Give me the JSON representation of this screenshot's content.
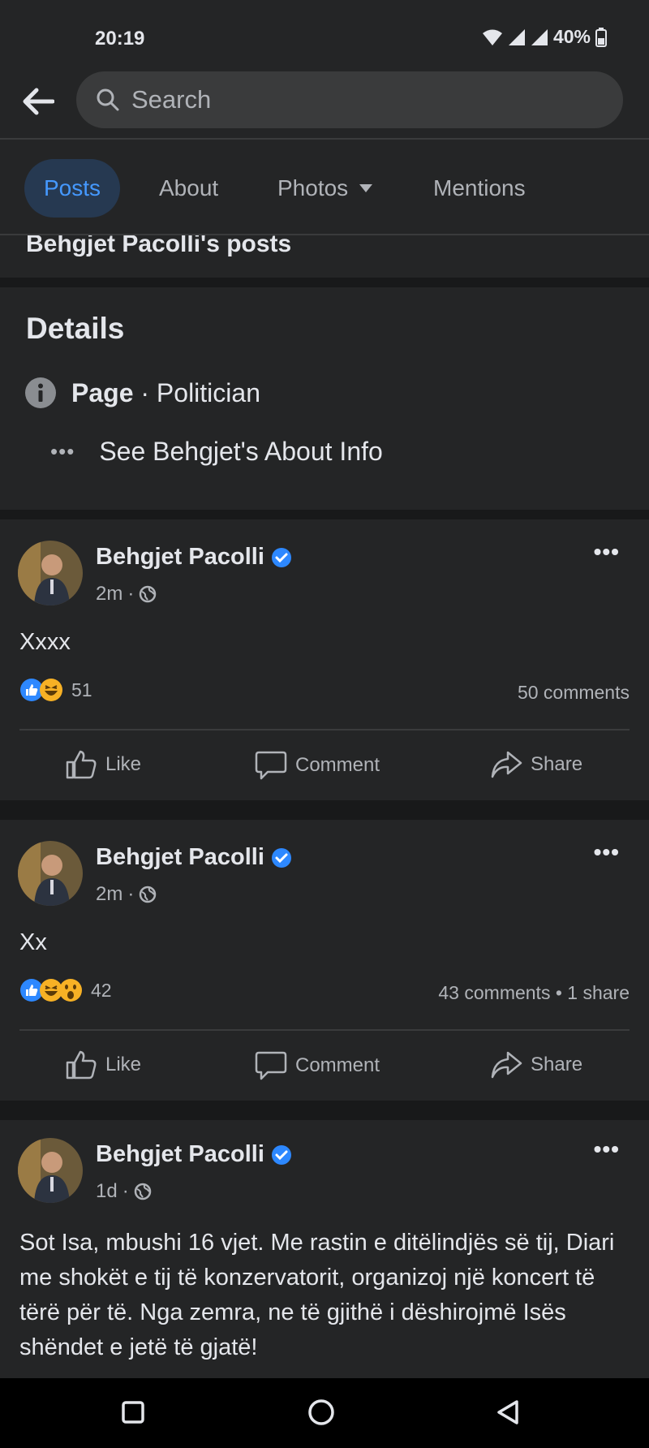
{
  "status": {
    "time": "20:19",
    "battery": "40%"
  },
  "search": {
    "placeholder": "Search"
  },
  "tabs": [
    {
      "label": "Posts"
    },
    {
      "label": "About"
    },
    {
      "label": "Photos"
    },
    {
      "label": "Mentions"
    }
  ],
  "posts_heading": "Behgjet Pacolli's posts",
  "details": {
    "title": "Details",
    "category_strong": "Page",
    "category_sep": " · ",
    "category": "Politician",
    "about_link": "See Behgjet's About Info"
  },
  "posts": [
    {
      "author": "Behgjet Pacolli",
      "time": "2m",
      "sep": " · ",
      "text": "Xxxx",
      "reaction_count": "51",
      "counts": "50 comments",
      "actions": {
        "like": "Like",
        "comment": "Comment",
        "share": "Share"
      }
    },
    {
      "author": "Behgjet Pacolli",
      "time": "2m",
      "sep": " · ",
      "text": "Xx",
      "reaction_count": "42",
      "counts": "43 comments • 1 share",
      "actions": {
        "like": "Like",
        "comment": "Comment",
        "share": "Share"
      }
    },
    {
      "author": "Behgjet Pacolli",
      "time": "1d",
      "sep": " · ",
      "text": "Sot Isa, mbushi 16 vjet. Me rastin e ditëlindjës së tij, Diari me shokët e tij të konzervatorit, organizoj një koncert të tërë për të. Nga zemra, ne të gjithë i dëshirojmë Isës shëndet e jetë të gjatë!"
    }
  ],
  "colors": {
    "background": "#18191a",
    "card": "#242526",
    "accent": "#4599ff",
    "muted": "#b0b3b8",
    "text": "#e4e6eb"
  }
}
